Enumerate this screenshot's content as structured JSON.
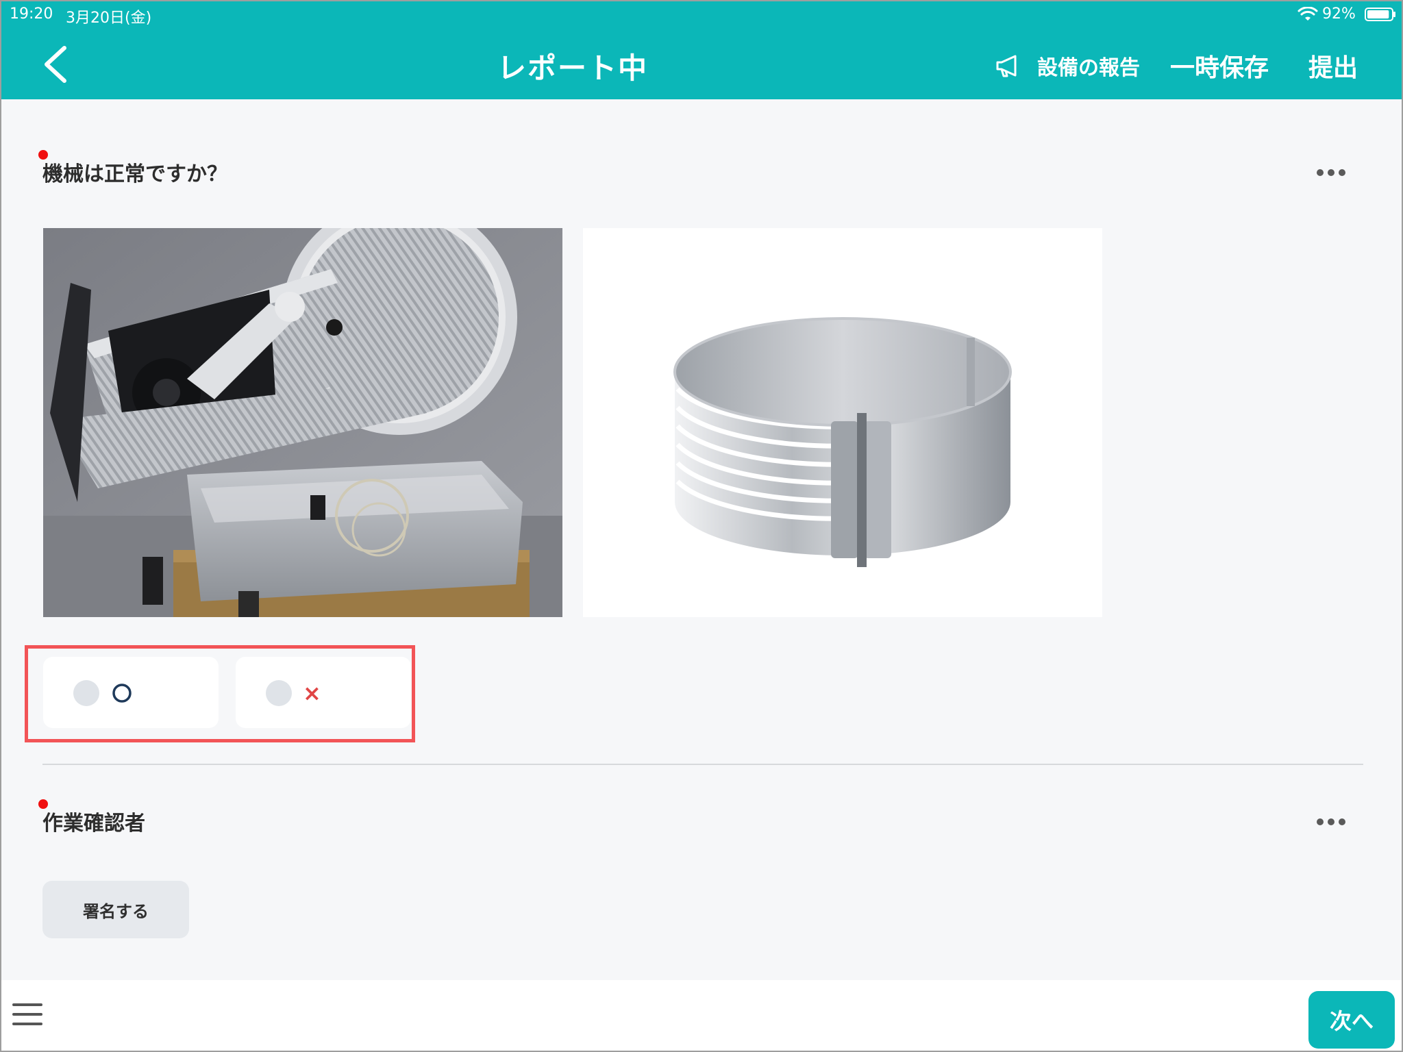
{
  "status_bar": {
    "time": "19:20",
    "date": "3月20日(金)",
    "battery_percent": "92%",
    "battery_level": 0.92
  },
  "header": {
    "title": "レポート中",
    "report_equipment_label": "設備の報告",
    "temp_save_label": "一時保存",
    "submit_label": "提出"
  },
  "questions": [
    {
      "label": "機械は正常ですか？",
      "required": true,
      "options": [
        {
          "label": "O",
          "color": "#1f3a5a",
          "selected": false
        },
        {
          "label": "×",
          "color": "#e04545",
          "selected": false
        }
      ]
    },
    {
      "label": "作業確認者",
      "required": true,
      "sign_button_label": "署名する"
    }
  ],
  "footer": {
    "next_label": "次へ"
  },
  "colors": {
    "accent": "#0bb7b8",
    "required_dot": "#f01010",
    "highlight_border": "#f25457",
    "background": "#f6f7f9"
  },
  "icons": [
    "back-chevron-icon",
    "megaphone-icon",
    "more-icon",
    "menu-icon",
    "wifi-icon",
    "battery-icon"
  ]
}
